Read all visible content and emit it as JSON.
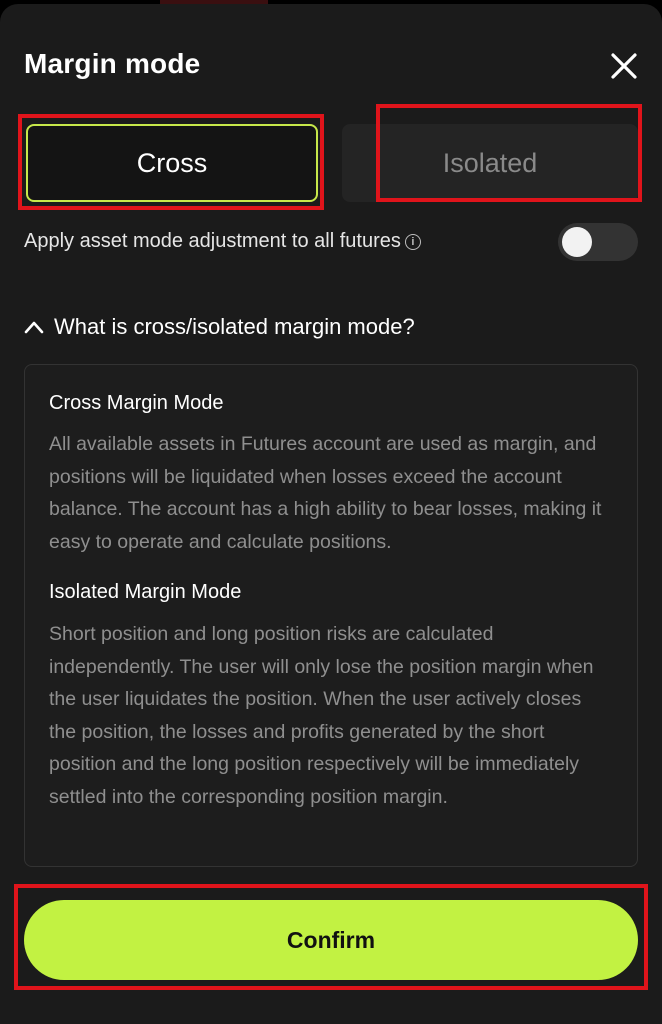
{
  "header": {
    "title": "Margin mode"
  },
  "modes": {
    "cross_label": "Cross",
    "isolated_label": "Isolated"
  },
  "apply_all": {
    "label": "Apply asset mode adjustment to all futures",
    "enabled": false
  },
  "faq": {
    "question": "What is cross/isolated margin mode?",
    "cross_title": "Cross Margin Mode",
    "cross_body": "All available assets in Futures account are used as margin, and positions will be liquidated when losses exceed the account balance. The account has a high ability to bear losses, making it easy to operate and calculate positions.",
    "isolated_title": "Isolated Margin Mode",
    "isolated_body": "Short position and long position risks are calculated independently. The user will only lose the position margin when the user liquidates the position. When the user actively closes the position, the losses and profits generated by the short position and the long position respectively will be immediately settled into the corresponding position margin."
  },
  "footer": {
    "confirm_label": "Confirm"
  },
  "colors": {
    "accent": "#c2f242",
    "highlight": "#e0141b",
    "sheet_bg": "#1b1b1b"
  }
}
